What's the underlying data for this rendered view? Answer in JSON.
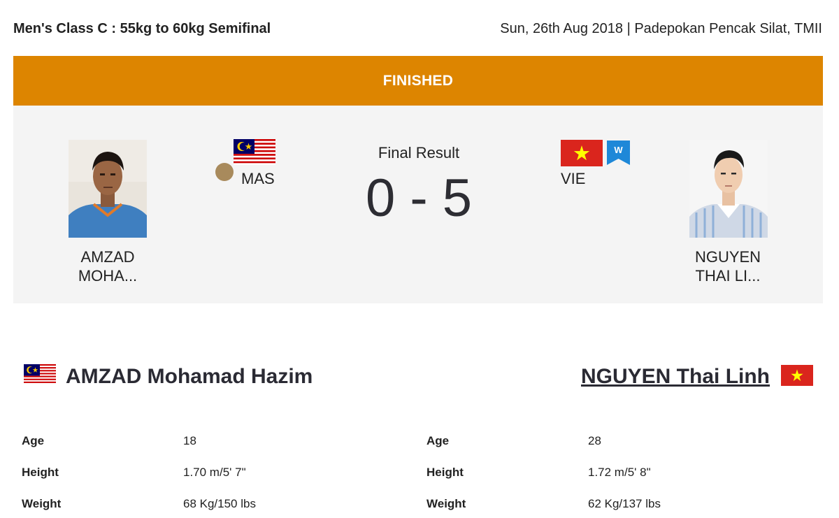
{
  "header": {
    "event_title": "Men's Class C : 55kg to 60kg Semifinal",
    "event_meta": "Sun, 26th Aug 2018 | Padepokan Pencak Silat, TMII"
  },
  "status": "FINISHED",
  "result": {
    "label": "Final Result",
    "score": "0 - 5",
    "winner_badge": "W"
  },
  "athletes": {
    "left": {
      "short_line1": "AMZAD",
      "short_line2": "MOHA...",
      "country_code": "MAS",
      "full_name": "AMZAD Mohamad Hazim",
      "medal": "bronze",
      "stats": [
        {
          "label": "Age",
          "value": "18"
        },
        {
          "label": "Height",
          "value": "1.70 m/5' 7\""
        },
        {
          "label": "Weight",
          "value": "68 Kg/150 lbs"
        }
      ]
    },
    "right": {
      "short_line1": "NGUYEN",
      "short_line2": "THAI LI...",
      "country_code": "VIE",
      "full_name": "NGUYEN Thai Linh",
      "stats": [
        {
          "label": "Age",
          "value": "28"
        },
        {
          "label": "Height",
          "value": "1.72 m/5' 8\""
        },
        {
          "label": "Weight",
          "value": "62 Kg/137 lbs"
        }
      ]
    }
  },
  "colors": {
    "status_bar": "#dd8500",
    "panel_bg": "#f4f4f4",
    "medal_bronze": "#a88a5c",
    "win_badge": "#1e88d8"
  }
}
